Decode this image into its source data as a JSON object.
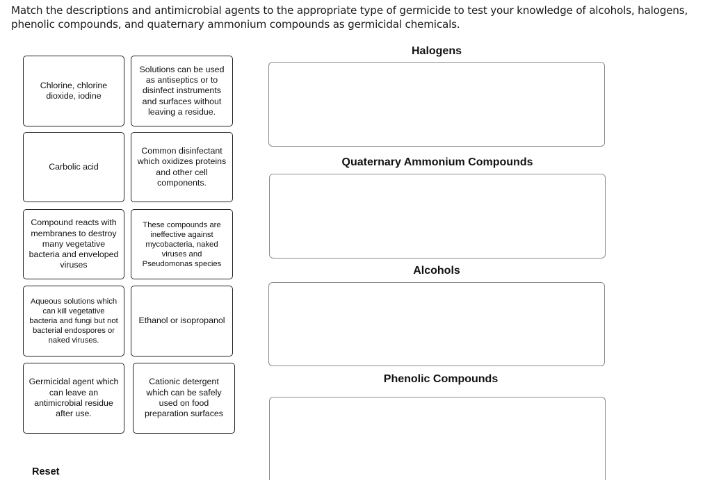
{
  "instructions": "Match the descriptions and antimicrobial agents to the appropriate type of germicide to test your knowledge of alcohols, halogens, phenolic compounds, and quaternary ammonium compounds as germicidal chemicals.",
  "cards": [
    {
      "text": "Chlorine, chlorine dioxide, iodine"
    },
    {
      "text": "Solutions can be used as antiseptics or to disinfect instruments and surfaces without leaving a residue."
    },
    {
      "text": "Carbolic acid"
    },
    {
      "text": "Common disinfectant which oxidizes proteins and other cell components."
    },
    {
      "text": "Compound reacts with membranes to destroy many vegetative bacteria and enveloped viruses"
    },
    {
      "text": "These compounds are ineffective against mycobacteria, naked viruses and Pseudomonas species"
    },
    {
      "text": "Aqueous solutions which can kill vegetative bacteria and fungi but not bacterial endospores or naked viruses."
    },
    {
      "text": "Ethanol or isopropanol"
    },
    {
      "text": "Germicidal agent which can leave an antimicrobial residue after use."
    },
    {
      "text": "Cationic detergent which can be safely used on food preparation surfaces"
    }
  ],
  "zones": [
    {
      "title": "Halogens"
    },
    {
      "title": "Quaternary Ammonium Compounds"
    },
    {
      "title": "Alcohols"
    },
    {
      "title": "Phenolic Compounds"
    }
  ],
  "reset_label": "Reset"
}
